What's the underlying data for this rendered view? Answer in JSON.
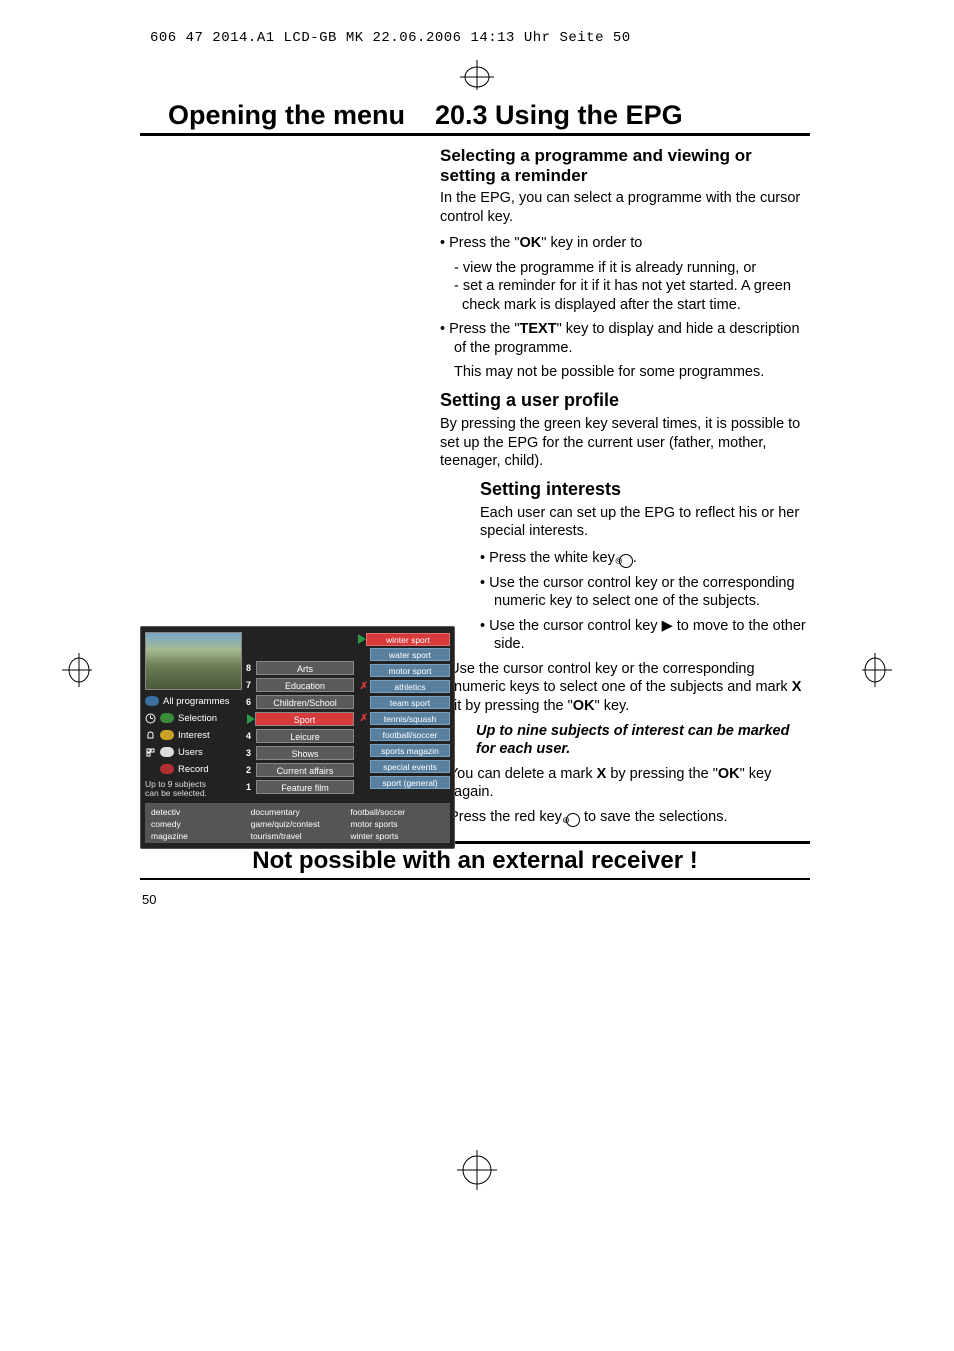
{
  "scan_header": "606 47 2014.A1 LCD-GB MK  22.06.2006  14:13 Uhr  Seite 50",
  "title_left": "Opening the menu",
  "title_right": "20.3 Using the EPG",
  "h3a": "Selecting a programme and viewing or setting a reminder",
  "p1": "In the EPG, you can select a programme with the cursor control key.",
  "b1_lead": "• Press the \"",
  "b1_key": "OK",
  "b1_tail": "\" key in order to",
  "b1_sub1": "- view the programme if it is already running, or",
  "b1_sub2": "- set a reminder for it if it has not yet started. A green check mark is displayed after the start time.",
  "b2_lead": "• Press the \"",
  "b2_key": "TEXT",
  "b2_tail": "\" key to display and hide a description of the programme.",
  "b2_extra": "This may not be possible for some programmes.",
  "h2a": "Setting a user profile",
  "p2": "By pressing the green key several times, it is possible to set up the EPG for the current user (father, mother, teenager, child).",
  "h2b": "Setting interests",
  "p3": "Each user can set up the EPG to reflect his or her special interests.",
  "b3": "• Press the white key ",
  "b4": "• Use the cursor control key or the corresponding numeric key to select one of the subjects.",
  "b5_lead": "• Use the cursor control key ",
  "b5_tail": " to move to the other side.",
  "b6_lead": "• Use the cursor control key or the corresponding numeric keys to select one of the subjects and mark ",
  "b6_x": "X",
  "b6_mid": " it by pressing the \"",
  "b6_key": "OK",
  "b6_tail": "\" key.",
  "note_hand": "☞",
  "note_text": "Up to nine subjects of interest can be marked for each user.",
  "b7_lead": "• You can delete a mark ",
  "b7_x": "X",
  "b7_mid": " by pressing the \"",
  "b7_key": "OK",
  "b7_tail": "\" key again.",
  "b8_lead": "• Press the red key ",
  "b8_tail": " to save the selections.",
  "bottom_bar": "Not possible with an external receiver !",
  "page_num": "50",
  "side": {
    "all": "All programmes",
    "selection": "Selection",
    "interest": "Interest",
    "users": "Users",
    "record": "Record",
    "footer1": "Up to 9 subjects",
    "footer2": "can be selected."
  },
  "cats": [
    {
      "n": "8",
      "label": "Arts"
    },
    {
      "n": "7",
      "label": "Education"
    },
    {
      "n": "6",
      "label": "Children/School"
    },
    {
      "n": "",
      "label": "Sport",
      "sel": true
    },
    {
      "n": "4",
      "label": "Leicure"
    },
    {
      "n": "3",
      "label": "Shows"
    },
    {
      "n": "2",
      "label": "Current affairs"
    },
    {
      "n": "1",
      "label": "Feature film"
    }
  ],
  "subs": [
    {
      "x": "",
      "label": "winter sport",
      "sel": true
    },
    {
      "x": "",
      "label": "water sport"
    },
    {
      "x": "",
      "label": "motor sport"
    },
    {
      "x": "✗",
      "label": "athletics"
    },
    {
      "x": "",
      "label": "team sport"
    },
    {
      "x": "✗",
      "label": "tennis/squash"
    },
    {
      "x": "",
      "label": "football/soccer"
    },
    {
      "x": "",
      "label": "sports magazin"
    },
    {
      "x": "",
      "label": "special events"
    },
    {
      "x": "",
      "label": "sport (general)"
    }
  ],
  "tags": [
    "detectiv",
    "documentary",
    "football/soccer",
    "comedy",
    "game/quiz/contest",
    "motor sports",
    "magazine",
    "tourism/travel",
    "winter sports"
  ]
}
